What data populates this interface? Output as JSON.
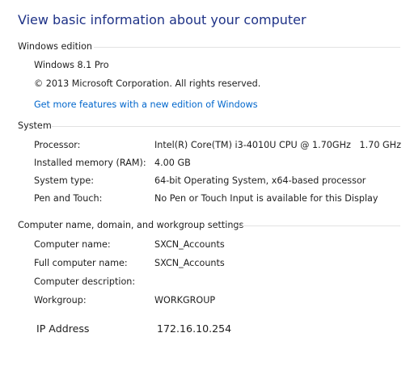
{
  "title": "View basic information about your computer",
  "windows_edition": {
    "heading": "Windows edition",
    "edition": "Windows 8.1 Pro",
    "copyright": "© 2013 Microsoft Corporation. All rights reserved.",
    "get_more_link": "Get more features with a new edition of Windows"
  },
  "system": {
    "heading": "System",
    "rows": [
      {
        "label": "Processor:",
        "value": "Intel(R) Core(TM) i3-4010U CPU @ 1.70GHz   1.70 GHz"
      },
      {
        "label": "Installed memory (RAM):",
        "value": "4.00 GB"
      },
      {
        "label": "System type:",
        "value": "64-bit Operating System, x64-based processor"
      },
      {
        "label": "Pen and Touch:",
        "value": "No Pen or Touch Input is available for this Display"
      }
    ]
  },
  "computer_name": {
    "heading": "Computer name, domain, and workgroup settings",
    "rows": [
      {
        "label": "Computer name:",
        "value": "SXCN_Accounts"
      },
      {
        "label": "Full computer name:",
        "value": "SXCN_Accounts"
      },
      {
        "label": "Computer description:",
        "value": ""
      },
      {
        "label": "Workgroup:",
        "value": "WORKGROUP"
      }
    ],
    "ip_label": "IP Address",
    "ip_value": "172.16.10.254"
  },
  "colors": {
    "title": "#1e3287",
    "link": "#0066cc",
    "rule": "#e2e2e2"
  }
}
